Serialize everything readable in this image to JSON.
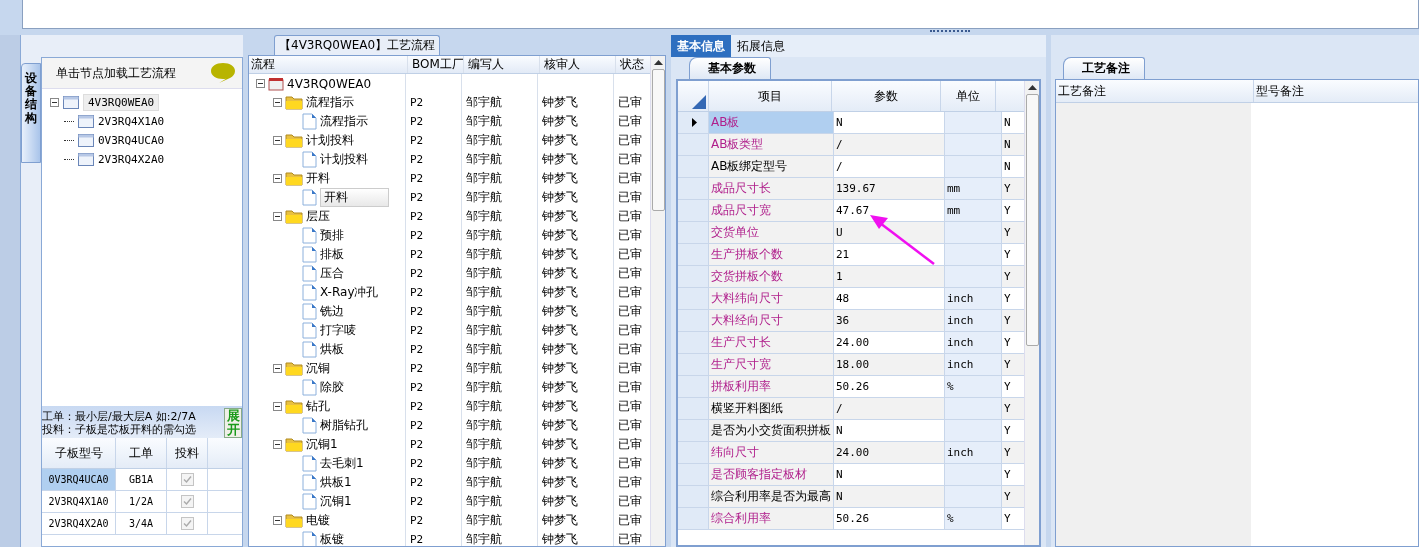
{
  "left_panel": {
    "vertical_tab": "设备结构",
    "hint": "单击节点加载工艺流程",
    "tree": {
      "label": "4V3RQ0WEA0",
      "expanded": true,
      "selected": true,
      "children": [
        {
          "label": "2V3RQ4X1A0",
          "selected": false
        },
        {
          "label": "0V3RQ4UCA0",
          "selected": false
        },
        {
          "label": "2V3RQ4X2A0",
          "selected": false
        }
      ]
    },
    "notes": [
      "工单：最小层/最大层A 如:2/7A",
      "投料：子板是芯板开料的需勾选"
    ],
    "expand_button": "展开",
    "subboards": {
      "columns": [
        "子板型号",
        "工单",
        "投料"
      ],
      "rows": [
        {
          "model": "0V3RQ4UCA0",
          "order": "GB1A",
          "feed": true,
          "selected": true
        },
        {
          "model": "2V3RQ4X1A0",
          "order": "1/2A",
          "feed": true,
          "selected": false
        },
        {
          "model": "2V3RQ4X2A0",
          "order": "3/4A",
          "feed": true,
          "selected": false
        }
      ]
    }
  },
  "process_panel": {
    "title": "【4V3RQ0WEA0】工艺流程",
    "columns": [
      "流程",
      "BOM工厂",
      "编写人",
      "核审人",
      "状态"
    ],
    "root": {
      "label": "4V3RQ0WEA0",
      "expanded": true,
      "children": [
        {
          "label": "流程指示",
          "bom": "P2",
          "writer": "邹宇航",
          "reviewer": "钟梦飞",
          "status": "已审",
          "expanded": true,
          "selected": false,
          "children": [
            {
              "label": "流程指示",
              "bom": "P2",
              "writer": "邹宇航",
              "reviewer": "钟梦飞",
              "status": "已审",
              "selected": false
            }
          ]
        },
        {
          "label": "计划投料",
          "bom": "P2",
          "writer": "邹宇航",
          "reviewer": "钟梦飞",
          "status": "已审",
          "expanded": true,
          "selected": false,
          "children": [
            {
              "label": "计划投料",
              "bom": "P2",
              "writer": "邹宇航",
              "reviewer": "钟梦飞",
              "status": "已审",
              "selected": false
            }
          ]
        },
        {
          "label": "开料",
          "bom": "P2",
          "writer": "邹宇航",
          "reviewer": "钟梦飞",
          "status": "已审",
          "expanded": true,
          "selected": false,
          "children": [
            {
              "label": "开料",
              "bom": "P2",
              "writer": "邹宇航",
              "reviewer": "钟梦飞",
              "status": "已审",
              "selected": true
            }
          ]
        },
        {
          "label": "层压",
          "bom": "P2",
          "writer": "邹宇航",
          "reviewer": "钟梦飞",
          "status": "已审",
          "expanded": true,
          "selected": false,
          "children": [
            {
              "label": "预排",
              "bom": "P2",
              "writer": "邹宇航",
              "reviewer": "钟梦飞",
              "status": "已审",
              "selected": false
            },
            {
              "label": "排板",
              "bom": "P2",
              "writer": "邹宇航",
              "reviewer": "钟梦飞",
              "status": "已审",
              "selected": false
            },
            {
              "label": "压合",
              "bom": "P2",
              "writer": "邹宇航",
              "reviewer": "钟梦飞",
              "status": "已审",
              "selected": false
            },
            {
              "label": "X-Ray冲孔",
              "bom": "P2",
              "writer": "邹宇航",
              "reviewer": "钟梦飞",
              "status": "已审",
              "selected": false
            },
            {
              "label": "铣边",
              "bom": "P2",
              "writer": "邹宇航",
              "reviewer": "钟梦飞",
              "status": "已审",
              "selected": false
            },
            {
              "label": "打字唛",
              "bom": "P2",
              "writer": "邹宇航",
              "reviewer": "钟梦飞",
              "status": "已审",
              "selected": false
            },
            {
              "label": "烘板",
              "bom": "P2",
              "writer": "邹宇航",
              "reviewer": "钟梦飞",
              "status": "已审",
              "selected": false
            }
          ]
        },
        {
          "label": "沉铜",
          "bom": "P2",
          "writer": "邹宇航",
          "reviewer": "钟梦飞",
          "status": "已审",
          "expanded": true,
          "selected": false,
          "children": [
            {
              "label": "除胶",
              "bom": "P2",
              "writer": "邹宇航",
              "reviewer": "钟梦飞",
              "status": "已审",
              "selected": false
            }
          ]
        },
        {
          "label": "钻孔",
          "bom": "P2",
          "writer": "邹宇航",
          "reviewer": "钟梦飞",
          "status": "已审",
          "expanded": true,
          "selected": false,
          "children": [
            {
              "label": "树脂钻孔",
              "bom": "P2",
              "writer": "邹宇航",
              "reviewer": "钟梦飞",
              "status": "已审",
              "selected": false
            }
          ]
        },
        {
          "label": "沉铜1",
          "bom": "P2",
          "writer": "邹宇航",
          "reviewer": "钟梦飞",
          "status": "已审",
          "expanded": true,
          "selected": false,
          "children": [
            {
              "label": "去毛刺1",
              "bom": "P2",
              "writer": "邹宇航",
              "reviewer": "钟梦飞",
              "status": "已审",
              "selected": false
            },
            {
              "label": "烘板1",
              "bom": "P2",
              "writer": "邹宇航",
              "reviewer": "钟梦飞",
              "status": "已审",
              "selected": false
            },
            {
              "label": "沉铜1",
              "bom": "P2",
              "writer": "邹宇航",
              "reviewer": "钟梦飞",
              "status": "已审",
              "selected": false
            }
          ]
        },
        {
          "label": "电镀",
          "bom": "P2",
          "writer": "邹宇航",
          "reviewer": "钟梦飞",
          "status": "已审",
          "expanded": true,
          "selected": false,
          "children": [
            {
              "label": "板镀",
              "bom": "P2",
              "writer": "邹宇航",
              "reviewer": "钟梦飞",
              "status": "已审",
              "selected": false
            }
          ]
        }
      ]
    }
  },
  "info_panel": {
    "tabs": [
      {
        "label": "基本信息",
        "selected": true
      },
      {
        "label": "拓展信息",
        "selected": false
      }
    ],
    "subtab": "基本参数",
    "columns": [
      "项目",
      "参数",
      "单位"
    ],
    "params": [
      {
        "item": "AB板",
        "value": "N",
        "flag": "N",
        "highlighted": true,
        "selected": true
      },
      {
        "item": "AB板类型",
        "value": "/",
        "flag": "N",
        "highlighted": true,
        "selected": false
      },
      {
        "item": "AB板绑定型号",
        "value": "/",
        "flag": "N",
        "highlighted": false,
        "selected": false
      },
      {
        "item": "成品尺寸长",
        "value": "139.67",
        "unit": "mm",
        "flag": "Y",
        "highlighted": true,
        "selected": false
      },
      {
        "item": "成品尺寸宽",
        "value": "47.67",
        "unit": "mm",
        "flag": "Y",
        "highlighted": true,
        "selected": false
      },
      {
        "item": "交货单位",
        "value": "U",
        "flag": "Y",
        "highlighted": true,
        "selected": false
      },
      {
        "item": "生产拼板个数",
        "value": "21",
        "flag": "Y",
        "highlighted": true,
        "selected": false
      },
      {
        "item": "交货拼板个数",
        "value": "1",
        "flag": "Y",
        "highlighted": true,
        "selected": false
      },
      {
        "item": "大料纬向尺寸",
        "value": "48",
        "unit": "inch",
        "flag": "Y",
        "highlighted": true,
        "selected": false
      },
      {
        "item": "大料经向尺寸",
        "value": "36",
        "unit": "inch",
        "flag": "Y",
        "highlighted": true,
        "selected": false
      },
      {
        "item": "生产尺寸长",
        "value": "24.00",
        "unit": "inch",
        "flag": "Y",
        "highlighted": true,
        "selected": false
      },
      {
        "item": "生产尺寸宽",
        "value": "18.00",
        "unit": "inch",
        "flag": "Y",
        "highlighted": true,
        "selected": false
      },
      {
        "item": "拼板利用率",
        "value": "50.26",
        "unit": "%",
        "flag": "Y",
        "highlighted": true,
        "selected": false
      },
      {
        "item": "横竖开料图纸",
        "value": "/",
        "flag": "Y",
        "highlighted": false,
        "selected": false
      },
      {
        "item": "是否为小交货面积拼板",
        "value": "N",
        "flag": "Y",
        "highlighted": false,
        "selected": false
      },
      {
        "item": "纬向尺寸",
        "value": "24.00",
        "unit": "inch",
        "flag": "Y",
        "highlighted": true,
        "selected": false
      },
      {
        "item": "是否顾客指定板材",
        "value": "N",
        "flag": "Y",
        "highlighted": true,
        "selected": false
      },
      {
        "item": "综合利用率是否为最高",
        "value": "N",
        "flag": "Y",
        "highlighted": false,
        "selected": false
      },
      {
        "item": "综合利用率",
        "value": "50.26",
        "unit": "%",
        "flag": "Y",
        "highlighted": true,
        "selected": false
      }
    ]
  },
  "notes_panel": {
    "tab": "工艺备注",
    "columns": [
      "工艺备注",
      "型号备注"
    ]
  }
}
